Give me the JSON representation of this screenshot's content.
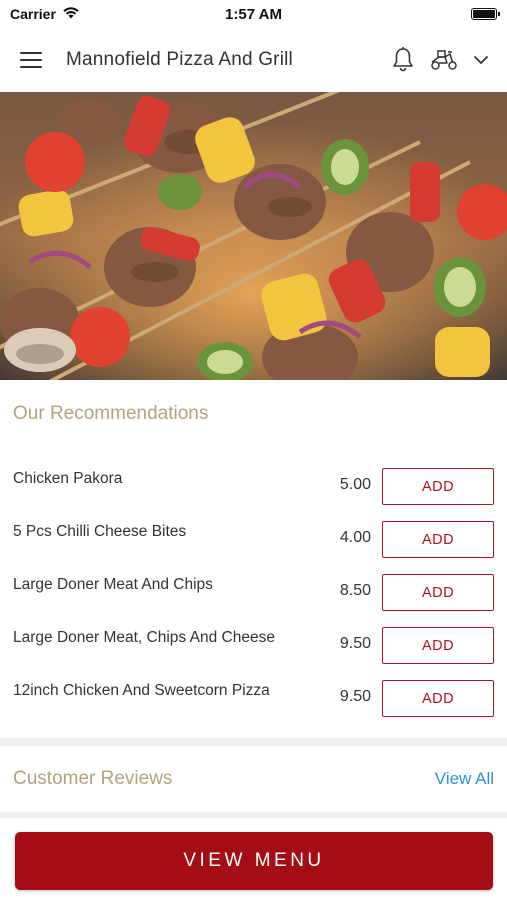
{
  "status_bar": {
    "carrier": "Carrier",
    "time": "1:57 AM"
  },
  "header": {
    "title": "Mannofield Pizza And Grill",
    "icons": [
      "menu-icon",
      "bell-icon",
      "scooter-icon",
      "chevron-down-icon"
    ]
  },
  "hero": {
    "image": "grilled kebab skewers"
  },
  "recommendations": {
    "title": "Our Recommendations",
    "items": [
      {
        "name": "Chicken Pakora",
        "price": "5.00",
        "button": "ADD"
      },
      {
        "name": "5 Pcs Chilli Cheese Bites",
        "price": "4.00",
        "button": "ADD"
      },
      {
        "name": "Large Doner Meat And Chips",
        "price": "8.50",
        "button": "ADD"
      },
      {
        "name": "Large Doner Meat, Chips And Cheese",
        "price": "9.50",
        "button": "ADD"
      },
      {
        "name": "12inch Chicken And Sweetcorn Pizza",
        "price": "9.50",
        "button": "ADD"
      }
    ]
  },
  "reviews": {
    "title": "Customer Reviews",
    "view_all": "View All"
  },
  "footer": {
    "view_menu": "VIEW MENU"
  },
  "colors": {
    "accent": "#a50d14",
    "section_title": "#b3a27c",
    "link": "#2f93c9"
  }
}
